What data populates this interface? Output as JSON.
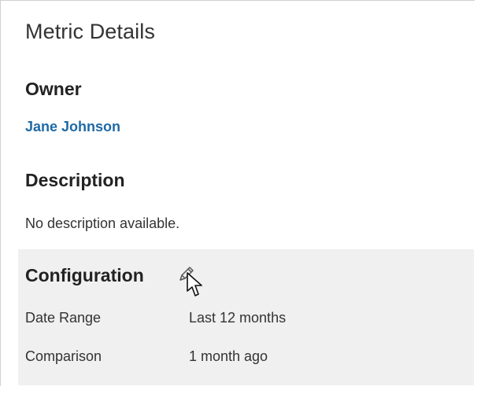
{
  "panel": {
    "title": "Metric Details"
  },
  "owner": {
    "heading": "Owner",
    "name": "Jane Johnson"
  },
  "description": {
    "heading": "Description",
    "text": "No description available."
  },
  "configuration": {
    "heading": "Configuration",
    "edit_icon": "pencil-icon",
    "cursor_icon": "pointer-cursor-icon",
    "rows": [
      {
        "label": "Date Range",
        "value": "Last 12 months"
      },
      {
        "label": "Comparison",
        "value": "1 month ago"
      }
    ]
  },
  "colors": {
    "link": "#1f6aa5",
    "config_background": "#f0f0f0",
    "border": "#d0d0d0"
  }
}
